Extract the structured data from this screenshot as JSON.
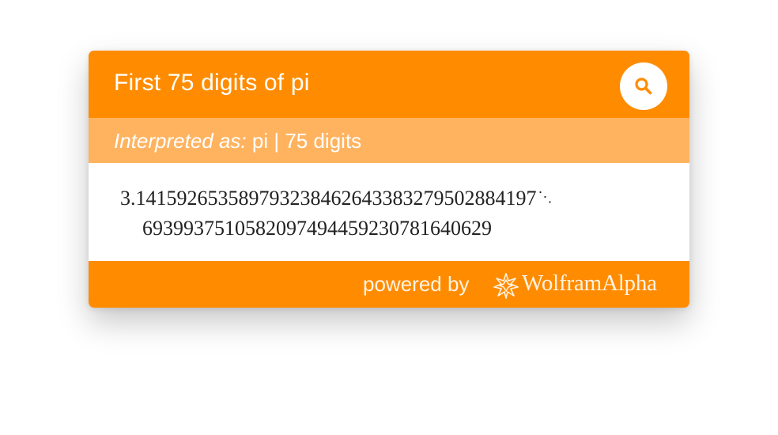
{
  "header": {
    "query": "First 75 digits of pi",
    "search_icon": "search-icon"
  },
  "interpretation": {
    "label": "Interpreted as:",
    "value": "pi | 75 digits"
  },
  "result": {
    "line1": "3.141592653589793238462643383279502884197",
    "line2": "6939937510582097494459230781640629",
    "continuation_mark": "⋱"
  },
  "footer": {
    "powered_by": "powered by",
    "brand": "WolframAlpha",
    "brand_icon": "wolfram-star-icon"
  },
  "colors": {
    "accent": "#ff8c00",
    "interpretation_bar": "#ffb35f",
    "text_light": "#ffffff"
  }
}
